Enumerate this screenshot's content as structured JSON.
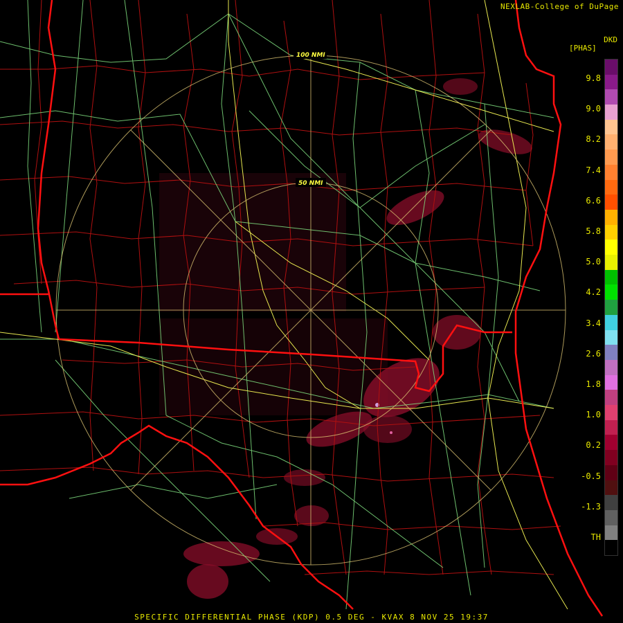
{
  "credit": "NEXLAB-College of DuPage",
  "product_units_line1": "DKD",
  "product_units_line2": "[PHAS]",
  "footer_caption": "SPECIFIC DIFFERENTIAL PHASE (KDP) 0.5 DEG - KVAX 8 NOV 25 19:37",
  "range_rings": [
    {
      "label": "100 NMI"
    },
    {
      "label": "50 NMI"
    }
  ],
  "colorbar": {
    "ticks": [
      "9.8",
      "9.0",
      "8.2",
      "7.4",
      "6.6",
      "5.8",
      "5.0",
      "4.2",
      "3.4",
      "2.6",
      "1.8",
      "1.0",
      "0.2",
      "-0.5",
      "-1.3",
      "TH"
    ],
    "colors": [
      "#6a0d6a",
      "#8a1a8a",
      "#b04bb0",
      "#e8a0d0",
      "#ffc490",
      "#ffb070",
      "#ff9a50",
      "#ff8030",
      "#ff6a10",
      "#ff5000",
      "#ffb000",
      "#ffd000",
      "#ffff00",
      "#e8f000",
      "#00c000",
      "#00e000",
      "#20a040",
      "#40d0e0",
      "#80e0f0",
      "#8080c0",
      "#c070c0",
      "#e070e0",
      "#c04080",
      "#e04070",
      "#c02050",
      "#a00030",
      "#800020",
      "#600015",
      "#501010",
      "#404040",
      "#606060",
      "#808080",
      "#000000"
    ]
  },
  "map": {
    "state_boundary_color": "#ff1010",
    "county_line_color": "#b01010",
    "highway_color": "#80e080",
    "interstate_color": "#e8e850",
    "range_ring_color": "#d8c070",
    "echo_color": "#8a0e2a"
  }
}
